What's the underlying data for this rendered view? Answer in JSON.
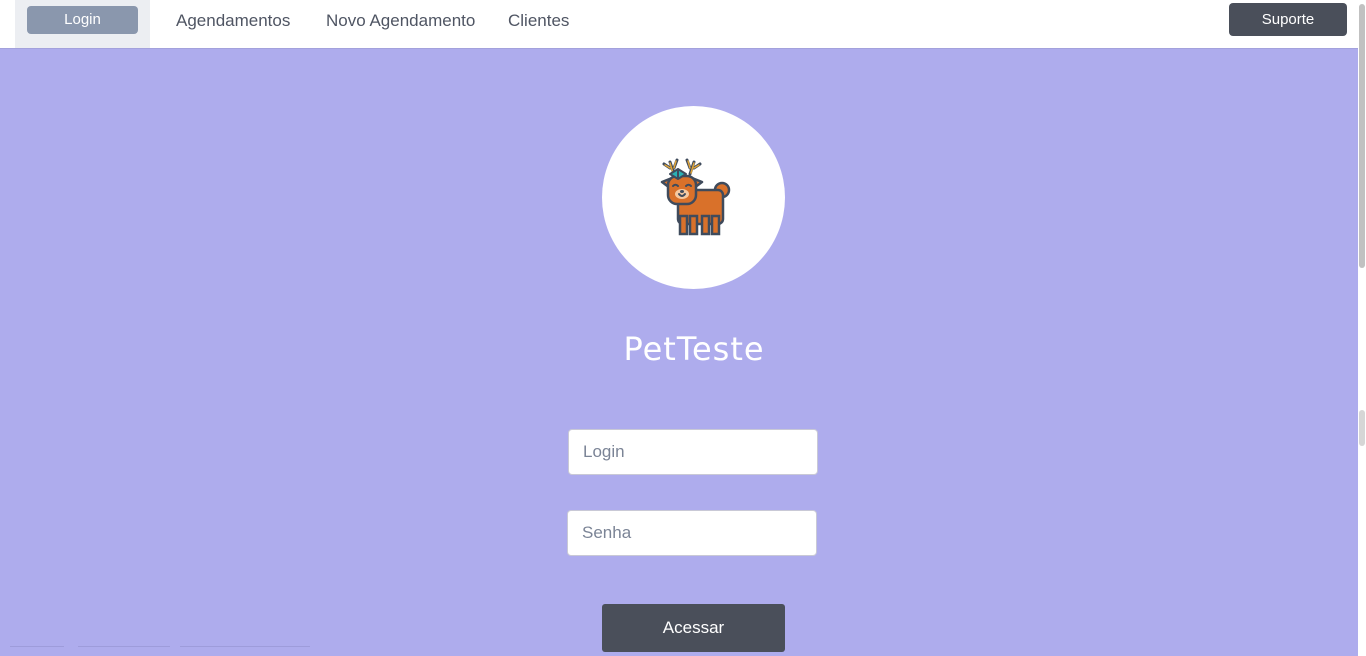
{
  "navbar": {
    "login_label": "Login",
    "links": [
      "Agendamentos",
      "Novo Agendamento",
      "Clientes"
    ],
    "support_label": "Suporte"
  },
  "logo": {
    "icon": "deer-icon"
  },
  "brand": {
    "name": "PetTeste"
  },
  "form": {
    "login_placeholder": "Login",
    "password_placeholder": "Senha",
    "submit_label": "Acessar"
  },
  "colors": {
    "background": "#aeaced",
    "dark_button": "#4a4f5a",
    "login_button": "#8a97ad"
  }
}
